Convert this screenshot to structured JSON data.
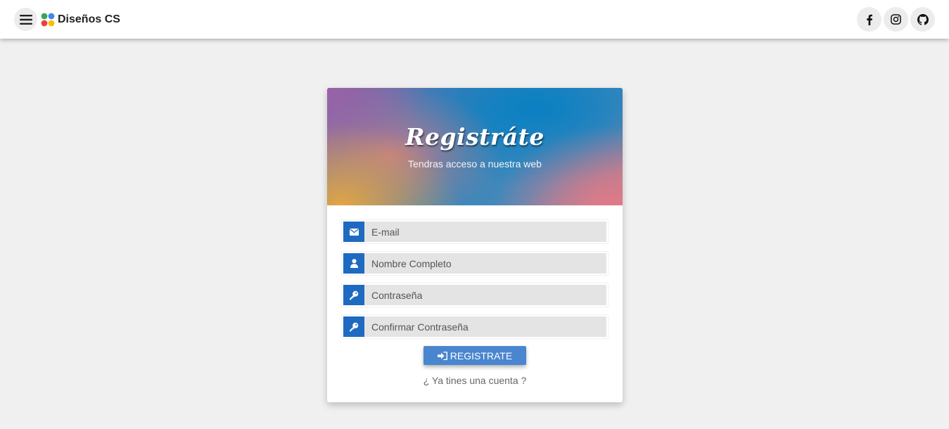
{
  "navbar": {
    "menu_icon": "hamburger-menu-icon",
    "brand_icon": "four-dots-logo-icon",
    "brand_name": "Diseños CS",
    "social": [
      {
        "icon": "facebook-icon"
      },
      {
        "icon": "instagram-icon"
      },
      {
        "icon": "github-icon"
      }
    ]
  },
  "card": {
    "title": "Registráte",
    "subtitle": "Tendras acceso a nuestra web",
    "fields": [
      {
        "icon": "envelope-icon",
        "placeholder": "E-mail"
      },
      {
        "icon": "user-icon",
        "placeholder": "Nombre Completo"
      },
      {
        "icon": "key-icon",
        "placeholder": "Contraseña"
      },
      {
        "icon": "key-icon",
        "placeholder": "Confirmar Contraseña"
      }
    ],
    "submit_icon": "sign-in-icon",
    "submit_label": "REGISTRATE",
    "login_link": "¿ Ya tines una cuenta ?"
  },
  "colors": {
    "accent": "#1e6ac0",
    "button": "#4a86cf",
    "background": "#f0f0f0",
    "logo_dots": [
      "#34a853",
      "#4285f4",
      "#ea4335",
      "#fbbc05"
    ]
  }
}
